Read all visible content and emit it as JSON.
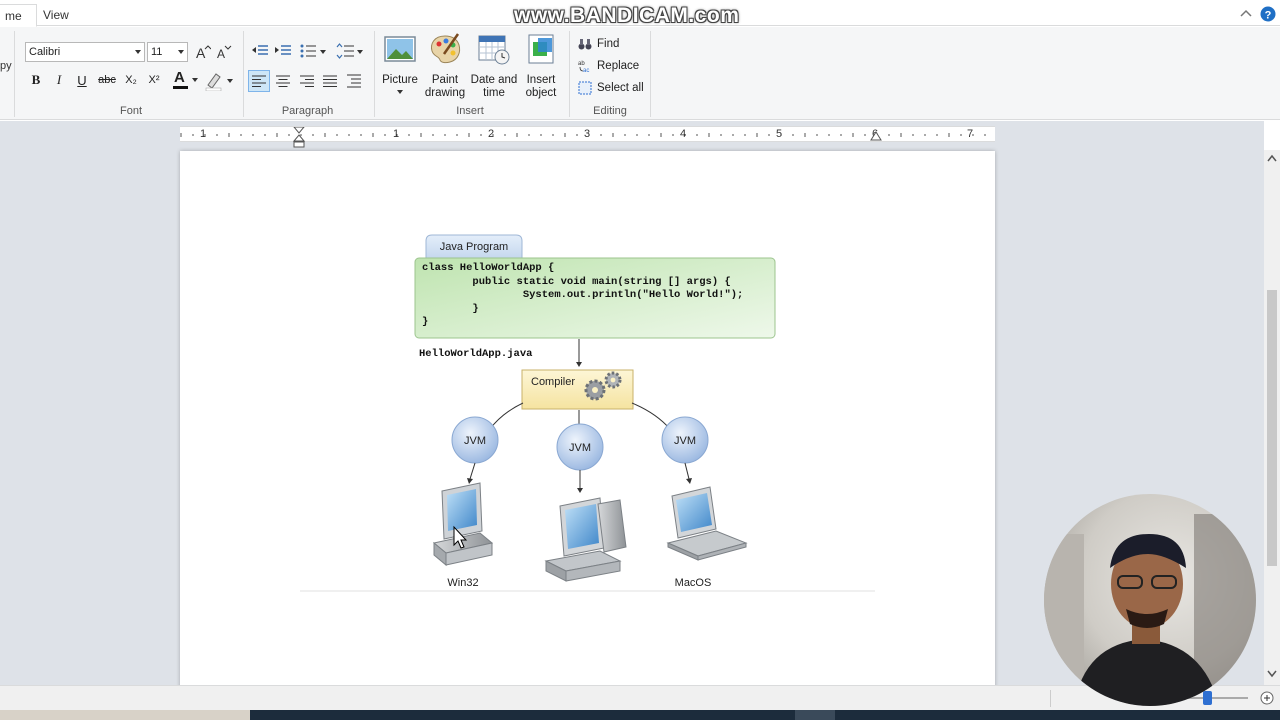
{
  "tabs": [
    {
      "label": "me",
      "active": true
    },
    {
      "label": "View",
      "active": false
    }
  ],
  "watermark": "www.BANDICAM.com",
  "ribbon": {
    "left_cut_label": "py",
    "font": {
      "family_value": "Calibri",
      "size_value": "11",
      "group_label": "Font",
      "bold": "B",
      "italic": "I",
      "underline": "U",
      "strike": "abc",
      "subscript": "X₂",
      "superscript": "X²",
      "text_color_letter": "A"
    },
    "paragraph": {
      "group_label": "Paragraph"
    },
    "insert": {
      "group_label": "Insert",
      "picture_label": "Picture",
      "paint_label": "Paint drawing",
      "date_label": "Date and time",
      "object_label": "Insert object"
    },
    "editing": {
      "group_label": "Editing",
      "find_label": "Find",
      "replace_label": "Replace",
      "select_all_label": "Select all"
    }
  },
  "ruler": {
    "numbers": [
      "1",
      "1",
      "2",
      "3",
      "4",
      "5",
      "6",
      "7"
    ]
  },
  "diagram": {
    "tab_label": "Java Program",
    "code_lines": [
      "class HelloWorldApp {",
      "        public static void main(string [] args) {",
      "                System.out.println(\"Hello World!\");",
      "        }",
      "}"
    ],
    "filename": "HelloWorldApp.java",
    "compiler_label": "Compiler",
    "jvm_labels": [
      "JVM",
      "JVM",
      "JVM"
    ],
    "platform_labels": [
      "Win32",
      "MacOS"
    ]
  },
  "colors": {
    "code_box": "#d9f0cf",
    "compiler_box": "#fbf1c4",
    "jvm_circle": "#bcd2ee",
    "page_bg": "#ffffff",
    "workspace_bg": "#dee2e8"
  }
}
